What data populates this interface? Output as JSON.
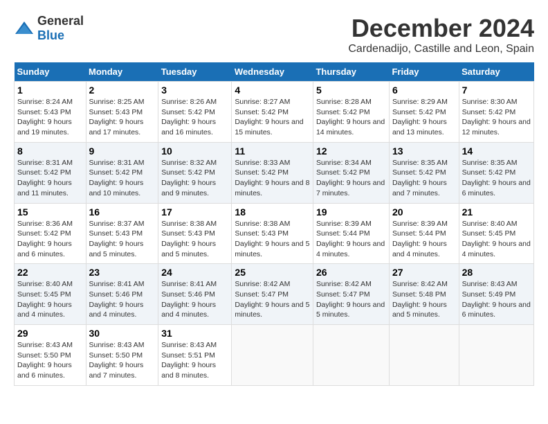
{
  "logo": {
    "general": "General",
    "blue": "Blue"
  },
  "header": {
    "month_year": "December 2024",
    "location": "Cardenadijo, Castille and Leon, Spain"
  },
  "days_of_week": [
    "Sunday",
    "Monday",
    "Tuesday",
    "Wednesday",
    "Thursday",
    "Friday",
    "Saturday"
  ],
  "weeks": [
    [
      {
        "day": "1",
        "sunrise": "Sunrise: 8:24 AM",
        "sunset": "Sunset: 5:43 PM",
        "daylight": "Daylight: 9 hours and 19 minutes."
      },
      {
        "day": "2",
        "sunrise": "Sunrise: 8:25 AM",
        "sunset": "Sunset: 5:43 PM",
        "daylight": "Daylight: 9 hours and 17 minutes."
      },
      {
        "day": "3",
        "sunrise": "Sunrise: 8:26 AM",
        "sunset": "Sunset: 5:42 PM",
        "daylight": "Daylight: 9 hours and 16 minutes."
      },
      {
        "day": "4",
        "sunrise": "Sunrise: 8:27 AM",
        "sunset": "Sunset: 5:42 PM",
        "daylight": "Daylight: 9 hours and 15 minutes."
      },
      {
        "day": "5",
        "sunrise": "Sunrise: 8:28 AM",
        "sunset": "Sunset: 5:42 PM",
        "daylight": "Daylight: 9 hours and 14 minutes."
      },
      {
        "day": "6",
        "sunrise": "Sunrise: 8:29 AM",
        "sunset": "Sunset: 5:42 PM",
        "daylight": "Daylight: 9 hours and 13 minutes."
      },
      {
        "day": "7",
        "sunrise": "Sunrise: 8:30 AM",
        "sunset": "Sunset: 5:42 PM",
        "daylight": "Daylight: 9 hours and 12 minutes."
      }
    ],
    [
      {
        "day": "8",
        "sunrise": "Sunrise: 8:31 AM",
        "sunset": "Sunset: 5:42 PM",
        "daylight": "Daylight: 9 hours and 11 minutes."
      },
      {
        "day": "9",
        "sunrise": "Sunrise: 8:31 AM",
        "sunset": "Sunset: 5:42 PM",
        "daylight": "Daylight: 9 hours and 10 minutes."
      },
      {
        "day": "10",
        "sunrise": "Sunrise: 8:32 AM",
        "sunset": "Sunset: 5:42 PM",
        "daylight": "Daylight: 9 hours and 9 minutes."
      },
      {
        "day": "11",
        "sunrise": "Sunrise: 8:33 AM",
        "sunset": "Sunset: 5:42 PM",
        "daylight": "Daylight: 9 hours and 8 minutes."
      },
      {
        "day": "12",
        "sunrise": "Sunrise: 8:34 AM",
        "sunset": "Sunset: 5:42 PM",
        "daylight": "Daylight: 9 hours and 7 minutes."
      },
      {
        "day": "13",
        "sunrise": "Sunrise: 8:35 AM",
        "sunset": "Sunset: 5:42 PM",
        "daylight": "Daylight: 9 hours and 7 minutes."
      },
      {
        "day": "14",
        "sunrise": "Sunrise: 8:35 AM",
        "sunset": "Sunset: 5:42 PM",
        "daylight": "Daylight: 9 hours and 6 minutes."
      }
    ],
    [
      {
        "day": "15",
        "sunrise": "Sunrise: 8:36 AM",
        "sunset": "Sunset: 5:42 PM",
        "daylight": "Daylight: 9 hours and 6 minutes."
      },
      {
        "day": "16",
        "sunrise": "Sunrise: 8:37 AM",
        "sunset": "Sunset: 5:43 PM",
        "daylight": "Daylight: 9 hours and 5 minutes."
      },
      {
        "day": "17",
        "sunrise": "Sunrise: 8:38 AM",
        "sunset": "Sunset: 5:43 PM",
        "daylight": "Daylight: 9 hours and 5 minutes."
      },
      {
        "day": "18",
        "sunrise": "Sunrise: 8:38 AM",
        "sunset": "Sunset: 5:43 PM",
        "daylight": "Daylight: 9 hours and 5 minutes."
      },
      {
        "day": "19",
        "sunrise": "Sunrise: 8:39 AM",
        "sunset": "Sunset: 5:44 PM",
        "daylight": "Daylight: 9 hours and 4 minutes."
      },
      {
        "day": "20",
        "sunrise": "Sunrise: 8:39 AM",
        "sunset": "Sunset: 5:44 PM",
        "daylight": "Daylight: 9 hours and 4 minutes."
      },
      {
        "day": "21",
        "sunrise": "Sunrise: 8:40 AM",
        "sunset": "Sunset: 5:45 PM",
        "daylight": "Daylight: 9 hours and 4 minutes."
      }
    ],
    [
      {
        "day": "22",
        "sunrise": "Sunrise: 8:40 AM",
        "sunset": "Sunset: 5:45 PM",
        "daylight": "Daylight: 9 hours and 4 minutes."
      },
      {
        "day": "23",
        "sunrise": "Sunrise: 8:41 AM",
        "sunset": "Sunset: 5:46 PM",
        "daylight": "Daylight: 9 hours and 4 minutes."
      },
      {
        "day": "24",
        "sunrise": "Sunrise: 8:41 AM",
        "sunset": "Sunset: 5:46 PM",
        "daylight": "Daylight: 9 hours and 4 minutes."
      },
      {
        "day": "25",
        "sunrise": "Sunrise: 8:42 AM",
        "sunset": "Sunset: 5:47 PM",
        "daylight": "Daylight: 9 hours and 5 minutes."
      },
      {
        "day": "26",
        "sunrise": "Sunrise: 8:42 AM",
        "sunset": "Sunset: 5:47 PM",
        "daylight": "Daylight: 9 hours and 5 minutes."
      },
      {
        "day": "27",
        "sunrise": "Sunrise: 8:42 AM",
        "sunset": "Sunset: 5:48 PM",
        "daylight": "Daylight: 9 hours and 5 minutes."
      },
      {
        "day": "28",
        "sunrise": "Sunrise: 8:43 AM",
        "sunset": "Sunset: 5:49 PM",
        "daylight": "Daylight: 9 hours and 6 minutes."
      }
    ],
    [
      {
        "day": "29",
        "sunrise": "Sunrise: 8:43 AM",
        "sunset": "Sunset: 5:50 PM",
        "daylight": "Daylight: 9 hours and 6 minutes."
      },
      {
        "day": "30",
        "sunrise": "Sunrise: 8:43 AM",
        "sunset": "Sunset: 5:50 PM",
        "daylight": "Daylight: 9 hours and 7 minutes."
      },
      {
        "day": "31",
        "sunrise": "Sunrise: 8:43 AM",
        "sunset": "Sunset: 5:51 PM",
        "daylight": "Daylight: 9 hours and 8 minutes."
      },
      null,
      null,
      null,
      null
    ]
  ]
}
